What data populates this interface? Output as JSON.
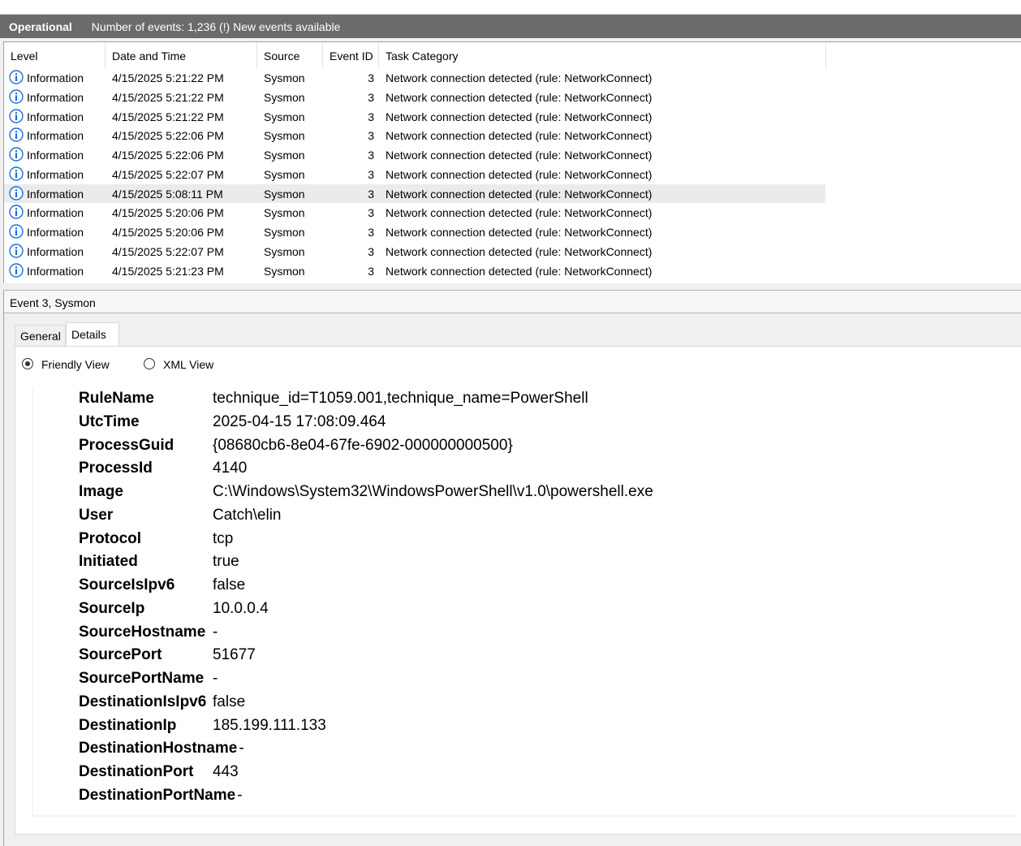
{
  "log": {
    "name": "Operational",
    "event_count_text": "Number of events: 1,236 (!) New events available"
  },
  "columns": {
    "level": "Level",
    "datetime": "Date and Time",
    "source": "Source",
    "event_id": "Event ID",
    "task_category": "Task Category"
  },
  "events": [
    {
      "level": "Information",
      "datetime": "4/15/2025 5:21:22 PM",
      "source": "Sysmon",
      "event_id": "3",
      "task": "Network connection detected (rule: NetworkConnect)"
    },
    {
      "level": "Information",
      "datetime": "4/15/2025 5:21:22 PM",
      "source": "Sysmon",
      "event_id": "3",
      "task": "Network connection detected (rule: NetworkConnect)"
    },
    {
      "level": "Information",
      "datetime": "4/15/2025 5:21:22 PM",
      "source": "Sysmon",
      "event_id": "3",
      "task": "Network connection detected (rule: NetworkConnect)"
    },
    {
      "level": "Information",
      "datetime": "4/15/2025 5:22:06 PM",
      "source": "Sysmon",
      "event_id": "3",
      "task": "Network connection detected (rule: NetworkConnect)"
    },
    {
      "level": "Information",
      "datetime": "4/15/2025 5:22:06 PM",
      "source": "Sysmon",
      "event_id": "3",
      "task": "Network connection detected (rule: NetworkConnect)"
    },
    {
      "level": "Information",
      "datetime": "4/15/2025 5:22:07 PM",
      "source": "Sysmon",
      "event_id": "3",
      "task": "Network connection detected (rule: NetworkConnect)"
    },
    {
      "level": "Information",
      "datetime": "4/15/2025 5:08:11 PM",
      "source": "Sysmon",
      "event_id": "3",
      "task": "Network connection detected (rule: NetworkConnect)",
      "selected": true
    },
    {
      "level": "Information",
      "datetime": "4/15/2025 5:20:06 PM",
      "source": "Sysmon",
      "event_id": "3",
      "task": "Network connection detected (rule: NetworkConnect)"
    },
    {
      "level": "Information",
      "datetime": "4/15/2025 5:20:06 PM",
      "source": "Sysmon",
      "event_id": "3",
      "task": "Network connection detected (rule: NetworkConnect)"
    },
    {
      "level": "Information",
      "datetime": "4/15/2025 5:22:07 PM",
      "source": "Sysmon",
      "event_id": "3",
      "task": "Network connection detected (rule: NetworkConnect)"
    },
    {
      "level": "Information",
      "datetime": "4/15/2025 5:21:23 PM",
      "source": "Sysmon",
      "event_id": "3",
      "task": "Network connection detected (rule: NetworkConnect)"
    }
  ],
  "detail": {
    "title": "Event 3, Sysmon",
    "tabs": {
      "general": "General",
      "details": "Details"
    },
    "active_tab": "Details",
    "views": {
      "friendly": "Friendly View",
      "xml": "XML View"
    },
    "selected_view": "Friendly View",
    "fields": [
      {
        "key": "RuleName",
        "value": "technique_id=T1059.001,technique_name=PowerShell"
      },
      {
        "key": "UtcTime",
        "value": "2025-04-15 17:08:09.464"
      },
      {
        "key": "ProcessGuid",
        "value": "{08680cb6-8e04-67fe-6902-000000000500}"
      },
      {
        "key": "ProcessId",
        "value": "4140"
      },
      {
        "key": "Image",
        "value": "C:\\Windows\\System32\\WindowsPowerShell\\v1.0\\powershell.exe"
      },
      {
        "key": "User",
        "value": "Catch\\elin"
      },
      {
        "key": "Protocol",
        "value": "tcp"
      },
      {
        "key": "Initiated",
        "value": "true"
      },
      {
        "key": "SourceIsIpv6",
        "value": "false"
      },
      {
        "key": "SourceIp",
        "value": "10.0.0.4"
      },
      {
        "key": "SourceHostname",
        "value": "-"
      },
      {
        "key": "SourcePort",
        "value": "51677"
      },
      {
        "key": "SourcePortName",
        "value": "-"
      },
      {
        "key": "DestinationIsIpv6",
        "value": "false"
      },
      {
        "key": "DestinationIp",
        "value": "185.199.111.133"
      },
      {
        "key": "DestinationHostname",
        "value": "-"
      },
      {
        "key": "DestinationPort",
        "value": "443"
      },
      {
        "key": "DestinationPortName",
        "value": "-"
      }
    ]
  },
  "colors": {
    "header_bar": "#6b6b6b",
    "info_icon": "#1e6fd9",
    "selected_row": "#ebebeb"
  }
}
